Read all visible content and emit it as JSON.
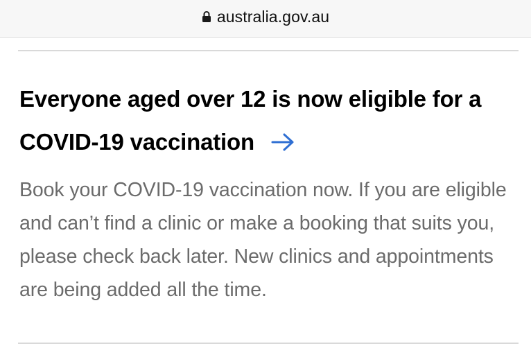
{
  "browser": {
    "url": "australia.gov.au"
  },
  "card": {
    "headline": "Everyone aged over 12 is now eligible for a COVID-19 vaccination",
    "body": "Book your COVID-19 vaccination now. If you are eligible and can’t find a clinic or make a booking that suits you, please check back later. New clinics and appointments are being added all the time."
  },
  "icons": {
    "lock": "lock-icon",
    "arrow": "arrow-right-icon"
  },
  "colors": {
    "link_arrow": "#2f6fd3",
    "body_text": "#6b6b6b",
    "headline": "#000000"
  }
}
